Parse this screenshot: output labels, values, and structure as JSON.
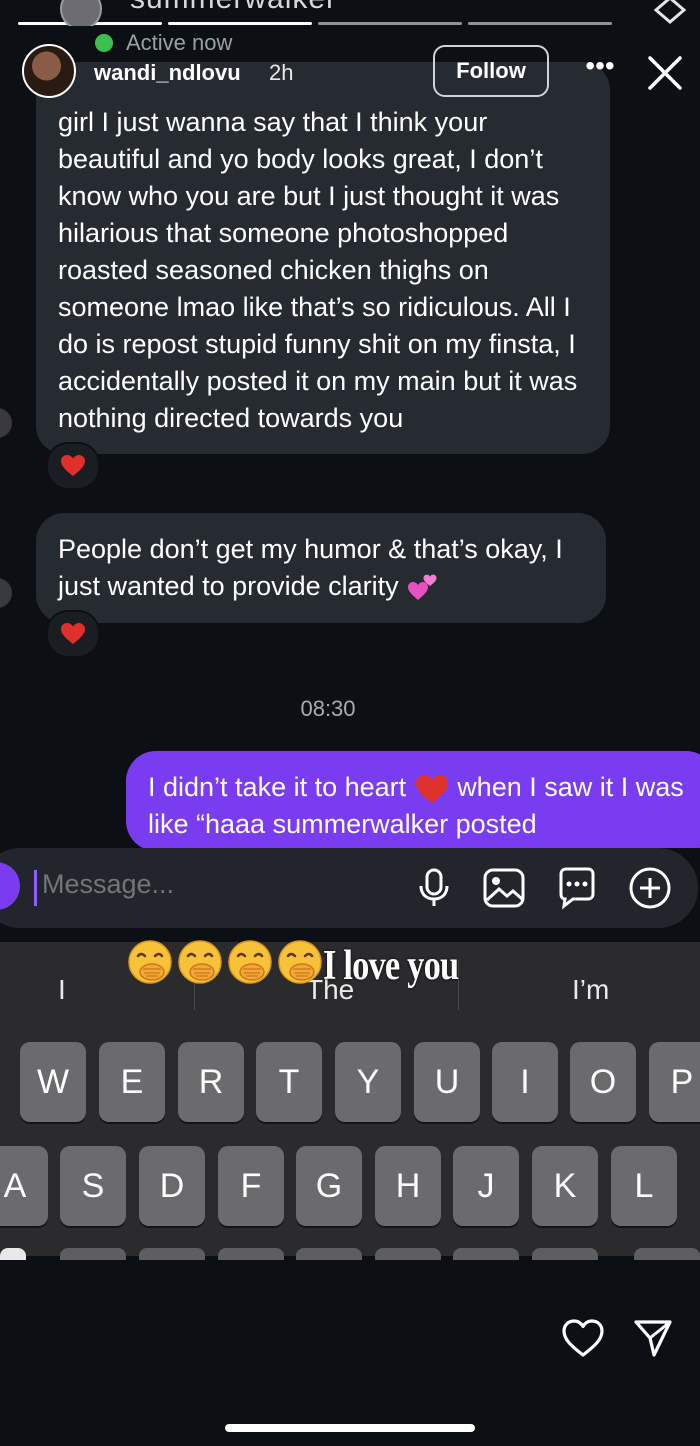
{
  "chat_header": {
    "name_fragment": "summerwalker",
    "status": "Active now"
  },
  "story": {
    "username": "wandi_ndlovu",
    "time_ago": "2h",
    "follow_label": "Follow",
    "more_label": "•••"
  },
  "messages": [
    {
      "sender": "them",
      "text": "girl I just wanna say that I think your beautiful and yo body looks great, I don’t know who you are but I just thought it was hilarious that someone photoshopped roasted seasoned chicken thighs on someone lmao like that’s so ridiculous. All I do is repost stupid funny shit on my finsta, I accidentally posted it on my main but it was nothing directed towards you",
      "reaction": "red-heart"
    },
    {
      "sender": "them",
      "text": "People don’t get my humor & that’s okay, I just wanted to provide clarity",
      "trailing_emoji": "two-hearts",
      "reaction": "red-heart"
    },
    {
      "sender": "me",
      "text_before_emoji": "I didn’t take it to heart",
      "inline_emoji": "red-heart",
      "text_after_emoji": "when I saw it I was like “haaa summerwalker posted"
    }
  ],
  "timestamp": "08:30",
  "composer": {
    "placeholder": "Message...",
    "icons": [
      "microphone-icon",
      "gallery-icon",
      "sticker-chat-icon",
      "plus-icon"
    ]
  },
  "keyboard": {
    "suggestions": [
      "I",
      "The",
      "I’m"
    ],
    "row1": [
      "W",
      "E",
      "R",
      "T",
      "Y",
      "U",
      "I",
      "O",
      "P"
    ],
    "row2": [
      "A",
      "S",
      "D",
      "F",
      "G",
      "H",
      "J",
      "K",
      "L"
    ]
  },
  "overlay_sticker": {
    "emojis": [
      "hand-over-mouth",
      "hand-over-mouth",
      "hand-over-mouth",
      "hand-over-mouth"
    ],
    "text": "I love you"
  },
  "story_footer": {
    "icons": [
      "heart-icon",
      "send-icon"
    ]
  },
  "colors": {
    "background": "#0c0f14",
    "their_bubble": "#262a31",
    "my_bubble": "#7a3cf0",
    "active_dot": "#3cc04d",
    "keyboard": "#2b2b2e",
    "key": "#6b6b6e",
    "heart_red": "#e0302c"
  }
}
